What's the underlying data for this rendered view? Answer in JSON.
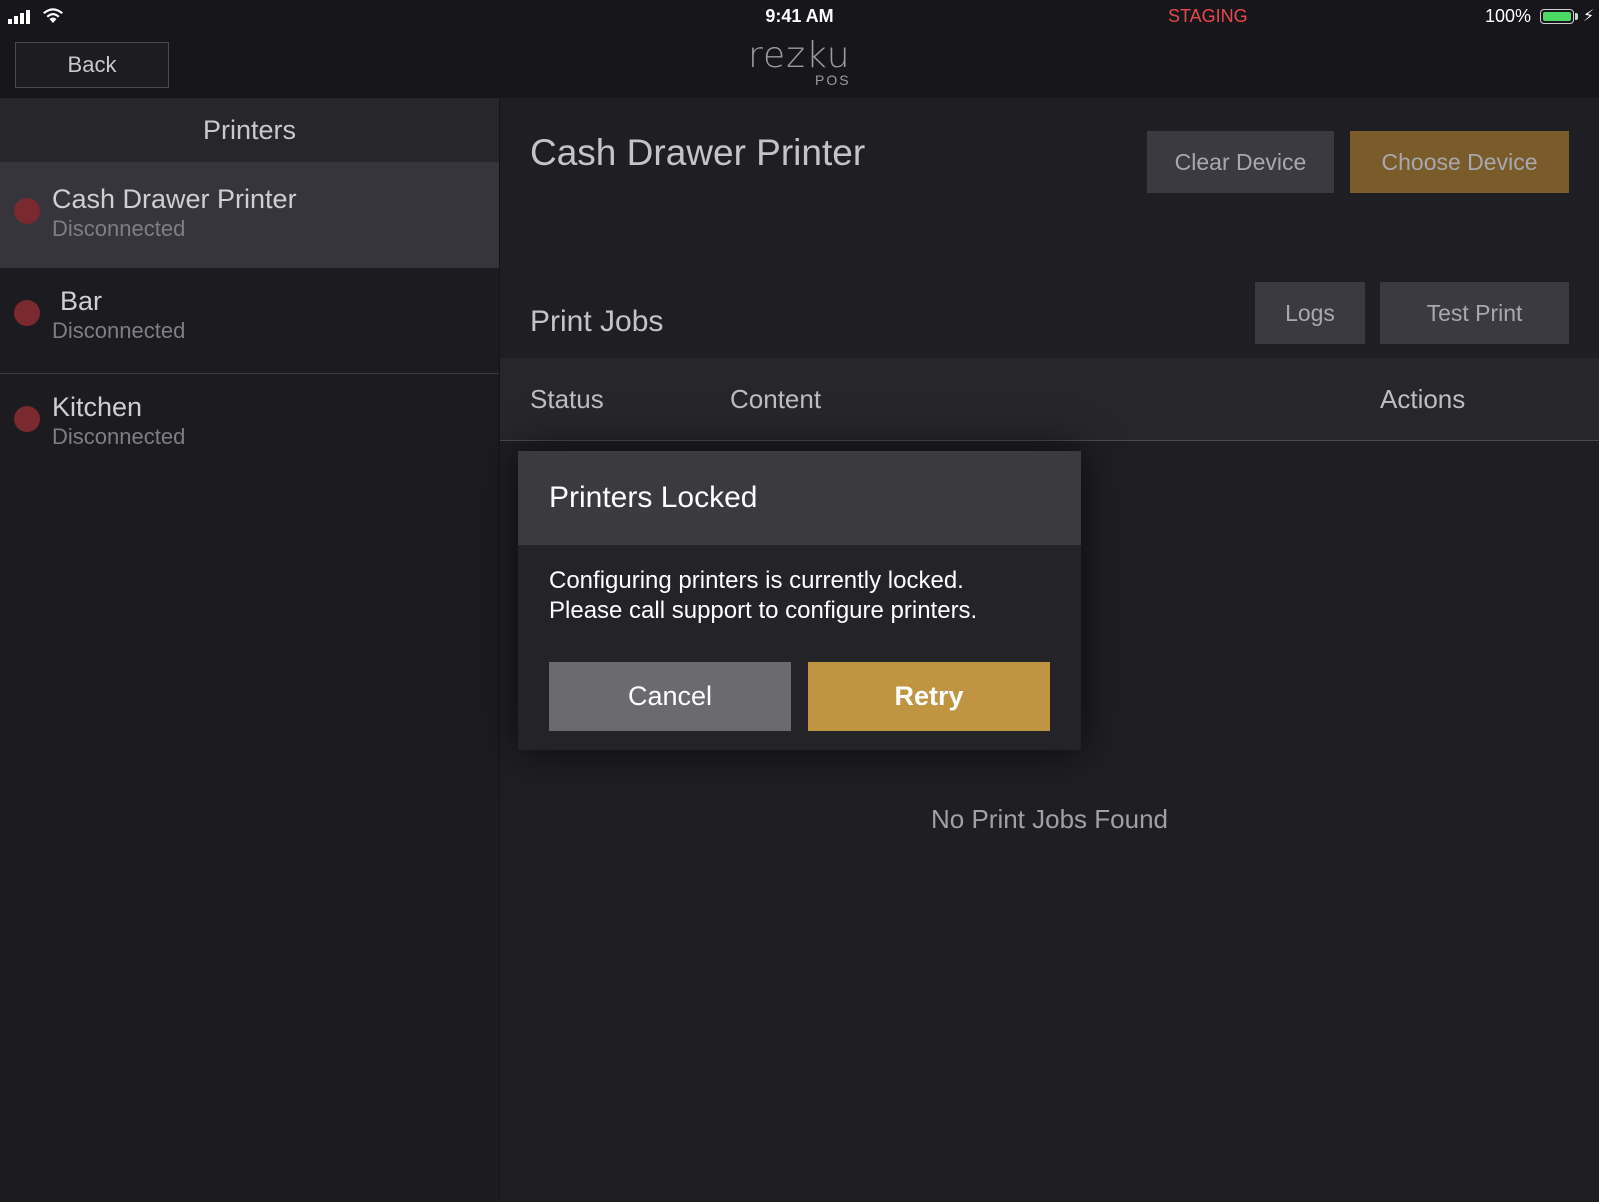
{
  "statusbar": {
    "time": "9:41 AM",
    "environment": "STAGING",
    "battery": "100%",
    "icons": [
      "signal-icon",
      "wifi-icon",
      "battery-icon",
      "charging-icon"
    ]
  },
  "nav": {
    "back_label": "Back",
    "logo": "rezku",
    "logo_sub": "POS"
  },
  "sidebar": {
    "title": "Printers",
    "items": [
      {
        "name": "Cash Drawer Printer",
        "status": "Disconnected"
      },
      {
        "name": "Bar",
        "status": "Disconnected"
      },
      {
        "name": "Kitchen",
        "status": "Disconnected"
      }
    ]
  },
  "main": {
    "device_title": "Cash Drawer Printer",
    "clear_device_label": "Clear Device",
    "choose_device_label": "Choose Device",
    "print_jobs_title": "Print Jobs",
    "logs_label": "Logs",
    "test_print_label": "Test Print",
    "columns": [
      "Status",
      "Content",
      "Actions"
    ],
    "empty_message": "No Print Jobs Found"
  },
  "modal": {
    "title": "Printers Locked",
    "message_line1": "Configuring printers is currently locked.",
    "message_line2": "Please call support to configure printers.",
    "cancel_label": "Cancel",
    "retry_label": "Retry"
  },
  "colors": {
    "accent_gold": "#bf9541",
    "staging_red": "#e5484d",
    "disconnected_dot": "#7a2a2e",
    "battery_green": "#4cd964"
  }
}
